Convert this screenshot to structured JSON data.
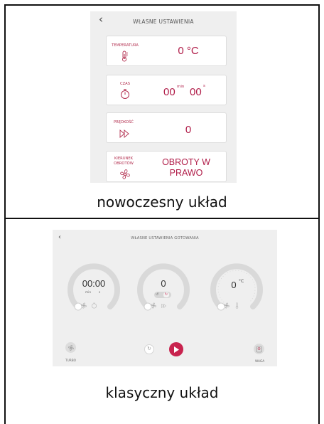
{
  "modern": {
    "back_icon": "chevron-left-icon",
    "title": "WŁASNE USTAWIENIA",
    "temperature": {
      "label": "TEMPERATURA",
      "value": "0 °C",
      "icon": "thermometer-icon"
    },
    "time": {
      "label": "CZAS",
      "minutes": "00",
      "seconds": "00",
      "min_unit": "min",
      "sec_unit": "s",
      "icon": "stopwatch-icon"
    },
    "speed": {
      "label": "PRĘDKOŚĆ",
      "value": "0",
      "icon": "fast-forward-icon"
    },
    "direction": {
      "label": "KIERUNEK OBROTÓW",
      "value": "OBROTY W PRAWO",
      "icon": "fan-icon"
    },
    "caption": "nowoczesny układ"
  },
  "classic": {
    "back_icon": "chevron-left-icon",
    "title": "WŁASNE USTAWIENIA GOTOWANIA",
    "time_dial": {
      "value": "00:00",
      "min_unit": "min",
      "sec_unit": "s"
    },
    "speed_dial": {
      "value": "0"
    },
    "temp_dial": {
      "value": "0",
      "unit": "°C"
    },
    "turbo_label": "TURBO",
    "waga_label": "WAGA",
    "caption": "klasyczny układ"
  },
  "colors": {
    "accent": "#c8234e",
    "panel": "#efefef",
    "dial_track": "#dcdcdc"
  }
}
